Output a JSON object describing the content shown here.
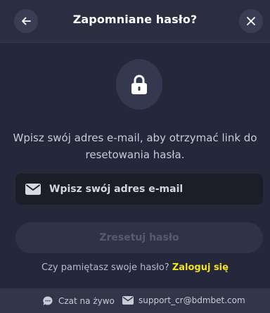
{
  "header": {
    "title": "Zapomniane hasło?",
    "back_icon": "arrow-left-icon",
    "close_icon": "close-icon"
  },
  "lock_icon": "lock-icon",
  "description_line1": "Wpisz swój adres e-mail, aby otrzymać link do",
  "description_line2": "resetowania hasła.",
  "email": {
    "placeholder": "Wpisz swój adres e-mail",
    "value": "",
    "icon": "envelope-icon"
  },
  "reset_button_label": "Zresetuj hasło",
  "login_prompt": "Czy pamiętasz swoje hasło?",
  "login_link": "Zaloguj się",
  "footer": {
    "chat_label": "Czat na żywo",
    "chat_icon": "chat-bubble-icon",
    "email_label": "support_cr@bdmbet.com",
    "email_icon": "envelope-icon"
  },
  "colors": {
    "background": "#25283a",
    "accent_link": "#f2e31c",
    "input_bg": "#1b1d29",
    "button_disabled_bg": "#2f3346"
  }
}
